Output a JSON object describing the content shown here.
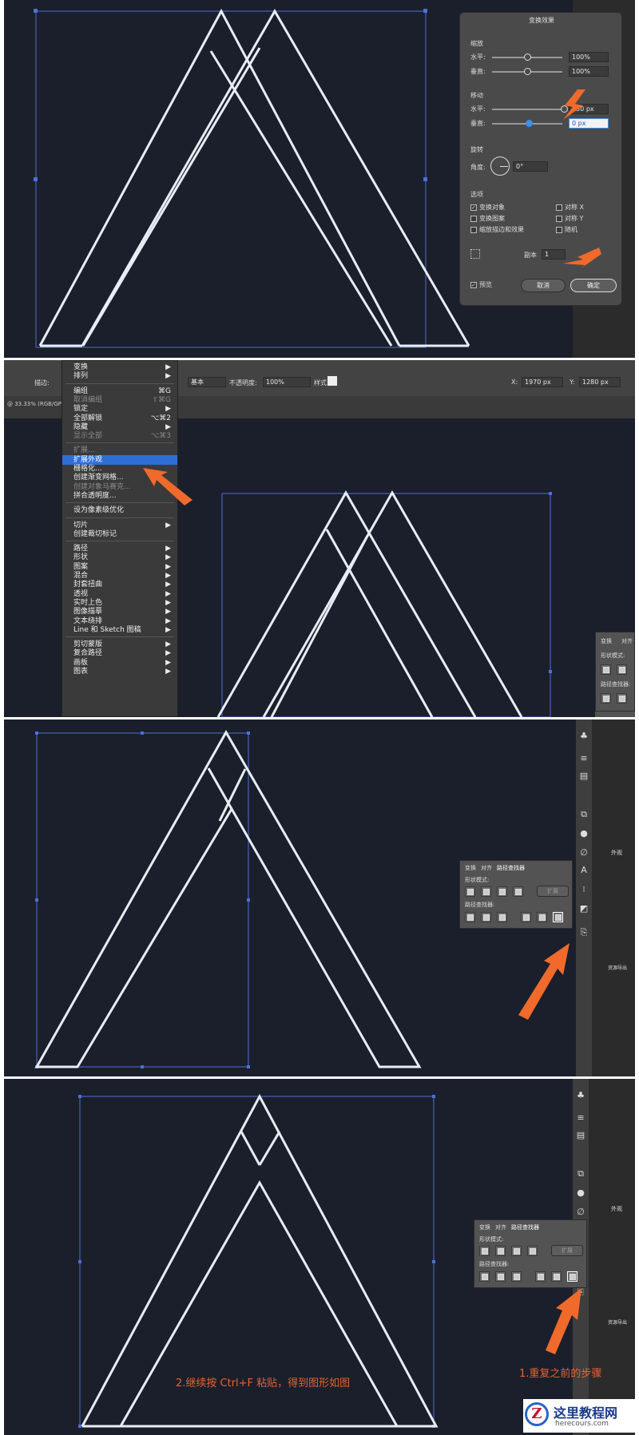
{
  "screen1": {
    "dialog": {
      "title": "变换效果",
      "scale_section": "缩放",
      "scale_h_label": "水平:",
      "scale_h_value": "100%",
      "scale_v_label": "垂直:",
      "scale_v_value": "100%",
      "move_section": "移动",
      "move_h_label": "水平:",
      "move_h_value": "250 px",
      "move_v_label": "垂直:",
      "move_v_value": "0 px",
      "rotate_section": "旋转",
      "angle_label": "角度:",
      "angle_value": "0°",
      "options_section": "选项",
      "opt_transform_objects": "变换对象",
      "opt_transform_objects_checked": true,
      "opt_transform_patterns": "变换图案",
      "opt_scale_strokes": "缩放描边和效果",
      "opt_reflect_x": "对称 X",
      "opt_reflect_y": "对称 Y",
      "opt_random": "随机",
      "copies_label": "副本",
      "copies_value": "1",
      "preview_label": "预览",
      "preview_checked": true,
      "cancel": "取消",
      "ok": "确定"
    }
  },
  "screen2": {
    "toolbar": {
      "stroke_label": "描边:",
      "style_basic": "基本",
      "opacity_label": "不透明度:",
      "opacity_value": "100%",
      "style_label": "样式:",
      "x_label": "X:",
      "x_value": "1970 px",
      "y_label": "Y:",
      "y_value": "1280 px",
      "doc_info": "@ 33.33% (RGB/GPU"
    },
    "menu": [
      {
        "label": "变换",
        "shortcut": "▶",
        "state": "normal"
      },
      {
        "label": "排列",
        "shortcut": "▶",
        "state": "normal"
      },
      {
        "label": "编组",
        "shortcut": "⌘G",
        "state": "normal"
      },
      {
        "label": "取消编组",
        "shortcut": "⇧⌘G",
        "state": "disabled"
      },
      {
        "label": "锁定",
        "shortcut": "▶",
        "state": "normal"
      },
      {
        "label": "全部解锁",
        "shortcut": "⌥⌘2",
        "state": "normal"
      },
      {
        "label": "隐藏",
        "shortcut": "▶",
        "state": "normal"
      },
      {
        "label": "显示全部",
        "shortcut": "⌥⌘3",
        "state": "disabled"
      },
      {
        "label": "扩展...",
        "shortcut": "",
        "state": "disabled"
      },
      {
        "label": "扩展外观",
        "shortcut": "",
        "state": "selected"
      },
      {
        "label": "栅格化...",
        "shortcut": "",
        "state": "normal"
      },
      {
        "label": "创建渐变网格...",
        "shortcut": "",
        "state": "normal"
      },
      {
        "label": "创建对象马赛克...",
        "shortcut": "",
        "state": "disabled"
      },
      {
        "label": "拼合透明度...",
        "shortcut": "",
        "state": "normal"
      },
      {
        "label": "设为像素级优化",
        "shortcut": "",
        "state": "normal"
      },
      {
        "label": "切片",
        "shortcut": "▶",
        "state": "normal"
      },
      {
        "label": "创建裁切标记",
        "shortcut": "",
        "state": "normal"
      },
      {
        "label": "路径",
        "shortcut": "▶",
        "state": "normal"
      },
      {
        "label": "形状",
        "shortcut": "▶",
        "state": "normal"
      },
      {
        "label": "图案",
        "shortcut": "▶",
        "state": "normal"
      },
      {
        "label": "混合",
        "shortcut": "▶",
        "state": "normal"
      },
      {
        "label": "封套扭曲",
        "shortcut": "▶",
        "state": "normal"
      },
      {
        "label": "透视",
        "shortcut": "▶",
        "state": "normal"
      },
      {
        "label": "实时上色",
        "shortcut": "▶",
        "state": "normal"
      },
      {
        "label": "图像描摹",
        "shortcut": "▶",
        "state": "normal"
      },
      {
        "label": "文本绕排",
        "shortcut": "▶",
        "state": "normal"
      },
      {
        "label": "Line 和 Sketch 图稿",
        "shortcut": "▶",
        "state": "normal"
      },
      {
        "label": "剪切蒙版",
        "shortcut": "▶",
        "state": "normal"
      },
      {
        "label": "复合路径",
        "shortcut": "▶",
        "state": "normal"
      },
      {
        "label": "画板",
        "shortcut": "▶",
        "state": "normal"
      },
      {
        "label": "图表",
        "shortcut": "▶",
        "state": "normal"
      }
    ],
    "panel": {
      "tab_transform": "变换",
      "tab_align": "对齐",
      "shape_modes": "形状模式:",
      "pathfinder": "路径查找器:"
    }
  },
  "screen3": {
    "panel": {
      "tab_transform": "变换",
      "tab_align": "对齐",
      "tab_pathfinder": "路径查找器",
      "shape_modes": "形状模式:",
      "expand": "扩展",
      "pathfinder": "路径查找器:"
    },
    "right_panel": {
      "appearance": "外观",
      "assets": "资源导出"
    }
  },
  "screen4": {
    "panel": {
      "tab_transform": "变换",
      "tab_align": "对齐",
      "tab_pathfinder": "路径查找器",
      "shape_modes": "形状模式:",
      "expand": "扩展",
      "pathfinder": "路径查找器:"
    },
    "right_panel": {
      "appearance": "外观",
      "assets": "资源导出"
    },
    "annotation_left": "2.继续按 Ctrl+F 粘贴，得到图形如图",
    "annotation_right": "1.重复之前的步骤"
  },
  "watermark": {
    "cn": "这里教程网",
    "url": "herecours.com"
  },
  "colors": {
    "canvas": "#1a1f2b",
    "stroke": "#e8ecf5",
    "selection": "#4d6fd8",
    "arrow": "#f06a2b",
    "annotation": "#e8622c"
  }
}
